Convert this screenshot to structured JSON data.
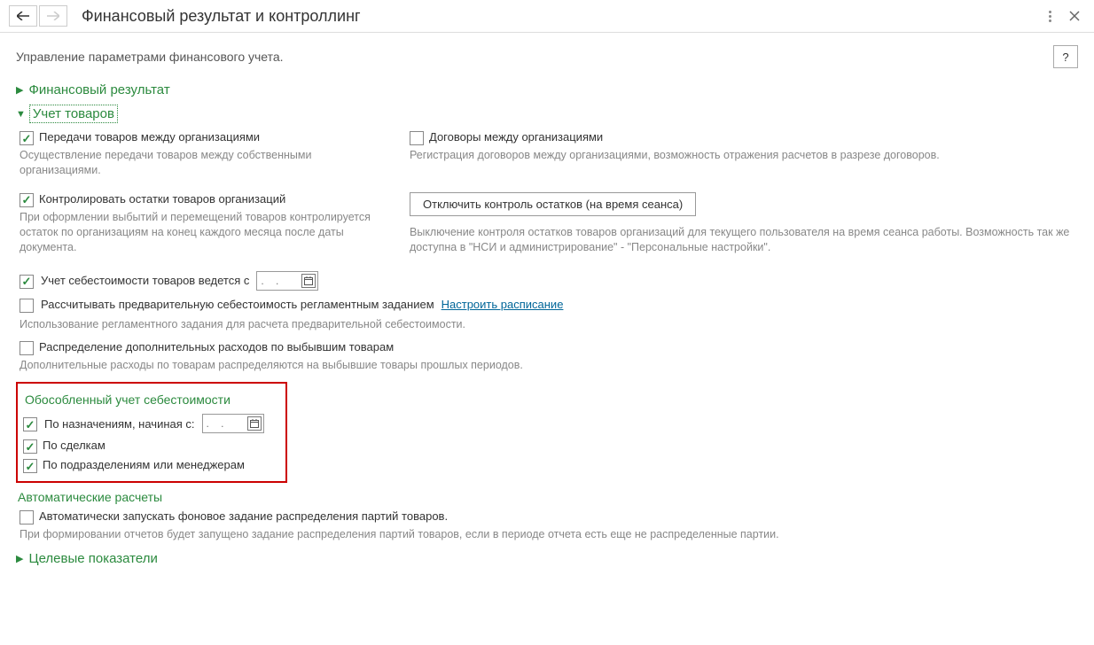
{
  "title": "Финансовый результат и контроллинг",
  "subheader": "Управление параметрами финансового учета.",
  "help_label": "?",
  "sections": {
    "fin_result": "Финансовый результат",
    "goods": "Учет товаров",
    "targets": "Целевые показатели"
  },
  "goods": {
    "transfer": {
      "label": "Передачи товаров между организациями",
      "desc": "Осуществление передачи товаров между собственными организациями."
    },
    "contracts": {
      "label": "Договоры между организациями",
      "desc": "Регистрация договоров между организациями, возможность отражения расчетов  в разрезе договоров."
    },
    "control": {
      "label": "Контролировать остатки товаров организаций",
      "desc": "При оформлении выбытий и перемещений товаров контролируется остаток по организациям на конец каждого месяца после даты документа."
    },
    "disable_btn": "Отключить контроль остатков (на время сеанса)",
    "disable_desc": "Выключение контроля остатков товаров организаций для текущего пользователя на время сеанса работы.  Возможность так же доступна в \"НСИ и администрирование\" - \"Персональные настройки\".",
    "cost_from": "Учет себестоимости товаров ведется с",
    "date_placeholder": ".    .",
    "precalc": "Рассчитывать предварительную себестоимость регламентным заданием",
    "schedule_link": "Настроить расписание",
    "precalc_desc": "Использование регламентного задания для расчета предварительной себестоимости.",
    "distrib": "Распределение дополнительных расходов по выбывшим товарам",
    "distrib_desc": "Дополнительные расходы по товарам распределяются на выбывшие товары прошлых периодов.",
    "separate_title": "Обособленный учет себестоимости",
    "by_purpose": "По назначениям, начиная с:",
    "by_deals": "По сделкам",
    "by_dept": "По подразделениям или менеджерам",
    "auto_title": "Автоматические расчеты",
    "auto_check": "Автоматически запускать фоновое задание распределения партий товаров.",
    "auto_desc": "При формировании отчетов будет запущено задание распределения партий товаров, если в периоде отчета есть еще не распределенные партии."
  }
}
